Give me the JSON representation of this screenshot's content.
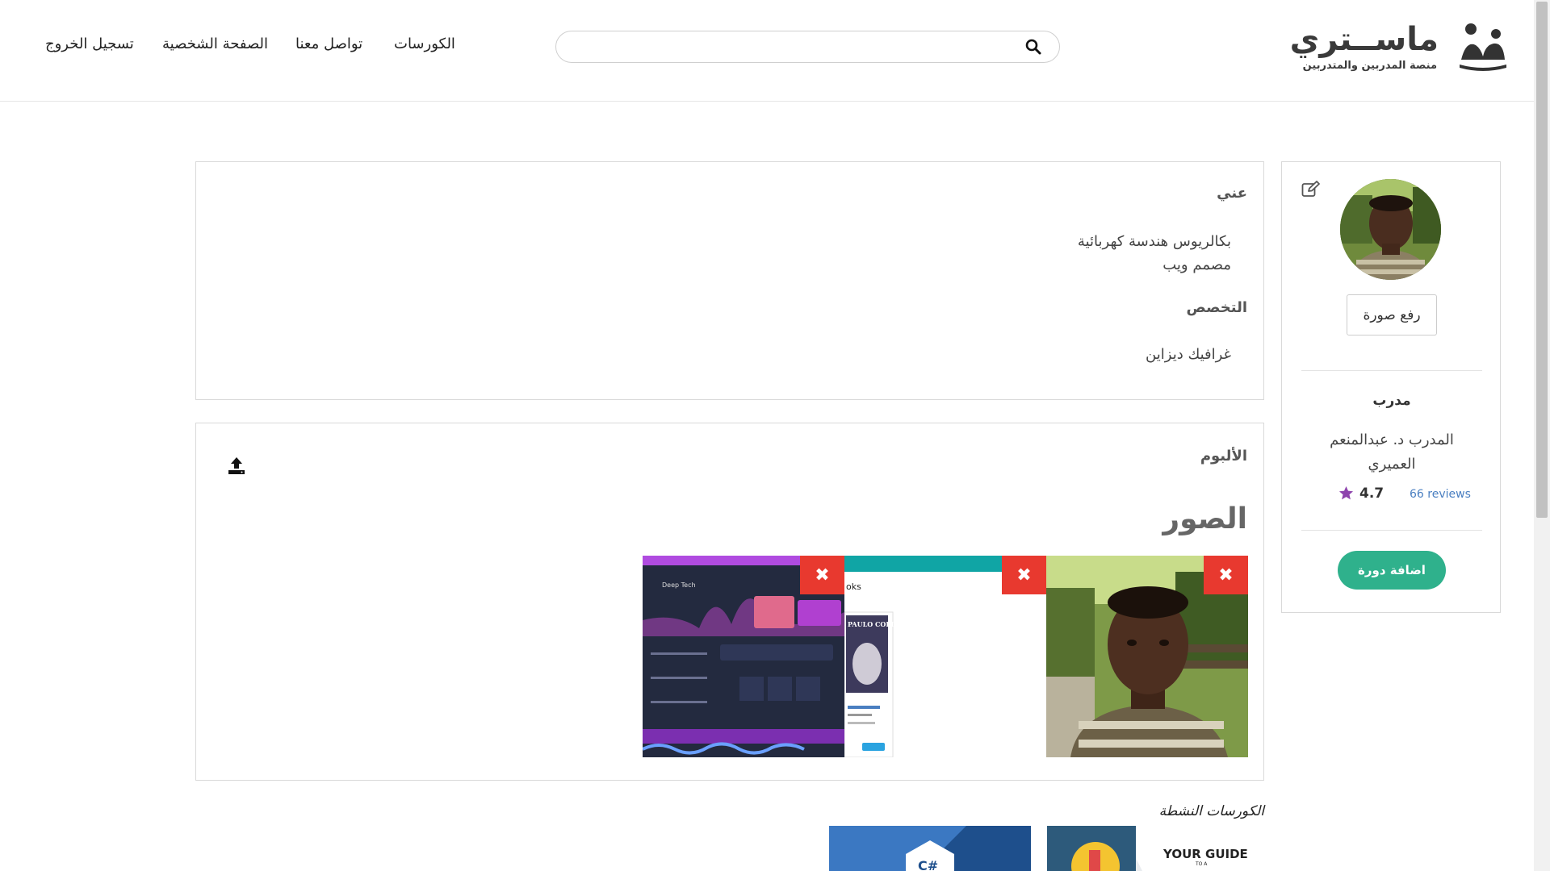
{
  "brand": {
    "name": "ماســتري",
    "tagline": "منصة المدربين والمتدربين"
  },
  "search": {
    "placeholder": "",
    "value": ""
  },
  "nav": {
    "courses": "الكورسات",
    "contact": "تواصل معنا",
    "profile": "الصفحة الشخصية",
    "logout": "تسجيل الخروج"
  },
  "profile": {
    "upload_photo_label": "رفع صورة",
    "role": "مدرب",
    "name": "المدرب د. عبدالمنعم العميري",
    "rating": "4.7",
    "reviews": "66 reviews",
    "add_course_label": "اضافة دورة",
    "star_color": "#8e44ad",
    "accent_color": "#2fb18c"
  },
  "about": {
    "title": "عني",
    "lines": [
      "بكالريوس هندسة كهربائية",
      "مصمم ويب"
    ],
    "specialty_title": "التخصص",
    "specialty_value": "غرافيك ديزاين"
  },
  "album": {
    "title": "الألبوم",
    "photos_title": "الصور",
    "delete_symbol": "✖",
    "photos": [
      {
        "type": "portrait-photo"
      },
      {
        "type": "books-app-screenshot",
        "caption_fragment": "oks",
        "book_title": "PAULO COELHO"
      },
      {
        "type": "music-app-screenshot",
        "app_name": "Deep Tech"
      }
    ]
  },
  "active_courses": {
    "title": "الكورسات النشطة",
    "courses": [
      {
        "thumb_text": "YOUR GUIDE",
        "thumb_sub": "TO A"
      },
      {
        "thumb_text": "C#"
      }
    ]
  }
}
